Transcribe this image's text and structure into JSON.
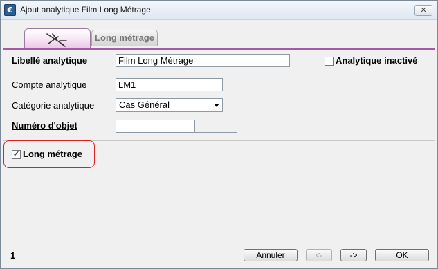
{
  "window": {
    "title": "Ajout analytique Film Long Métrage",
    "close_label": "✕"
  },
  "tabs": {
    "active_icon": "pin-icon",
    "secondary_label": "Long métrage"
  },
  "form": {
    "libelle_label": "Libellé analytique",
    "libelle_value": "Film Long Métrage",
    "inactive_label": "Analytique inactivé",
    "inactive_checked": false,
    "compte_label": "Compte analytique",
    "compte_value": "LM1",
    "categorie_label": "Catégorie analytique",
    "categorie_value": "Cas Général",
    "numero_label": "Numéro d'objet",
    "numero_value": "",
    "numero_extra": "",
    "long_metrage_label": "Long métrage",
    "long_metrage_checked": true
  },
  "footer": {
    "page_number": "1",
    "cancel_label": "Annuler",
    "prev_label": "<-",
    "next_label": "->",
    "ok_label": "OK"
  },
  "colors": {
    "accent": "#a55aa5",
    "highlight": "#e02020"
  }
}
